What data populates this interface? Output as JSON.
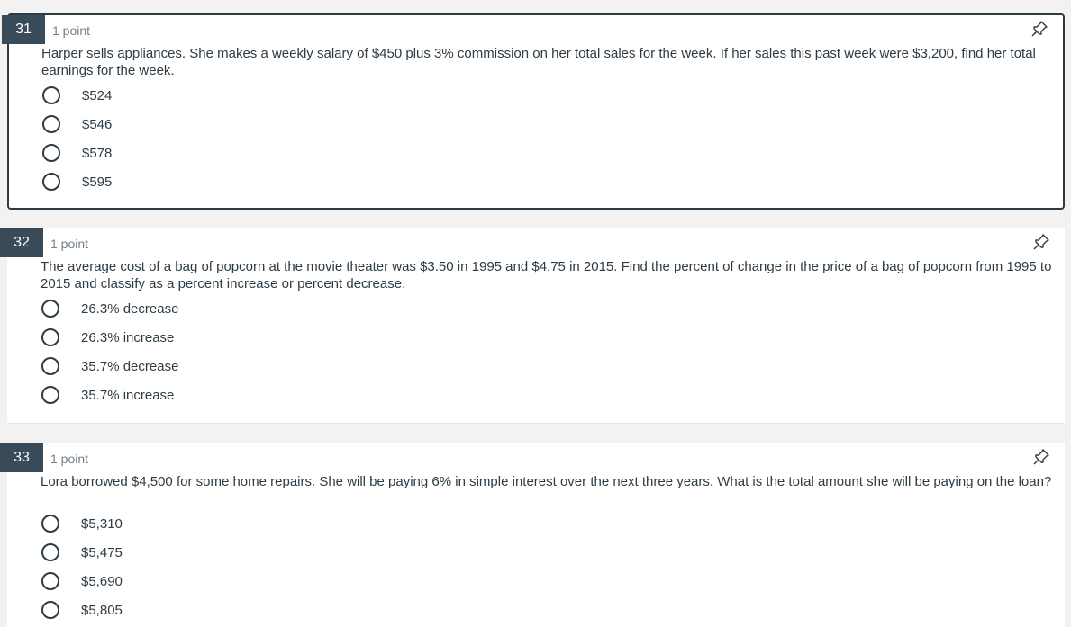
{
  "questions": [
    {
      "number": "31",
      "points": "1 point",
      "text": "Harper sells appliances. She makes a weekly salary of $450 plus 3% commission on her total sales for the week. If her sales this past week were $3,200, find her total earnings for the week.",
      "options": [
        "$524",
        "$546",
        "$578",
        "$595"
      ]
    },
    {
      "number": "32",
      "points": "1 point",
      "text": "The average cost of a bag of popcorn at the movie theater was $3.50 in 1995 and $4.75 in 2015. Find the percent of change in the price of a bag of popcorn from 1995 to 2015 and classify as a percent increase or percent decrease.",
      "options": [
        "26.3% decrease",
        "26.3% increase",
        "35.7% decrease",
        "35.7% increase"
      ]
    },
    {
      "number": "33",
      "points": "1 point",
      "text": "Lora borrowed $4,500 for some home repairs. She will be paying 6% in simple interest over the next three years. What is the total amount she will be paying on the loan?",
      "options": [
        "$5,310",
        "$5,475",
        "$5,690",
        "$5,805"
      ]
    }
  ],
  "icons": {
    "pin": "pin-icon",
    "radio": "radio-circle-icon"
  },
  "colors": {
    "number_badge": "#394b58",
    "text": "#2d3b45",
    "muted": "#73818c",
    "active_border": "#2d3b45"
  }
}
